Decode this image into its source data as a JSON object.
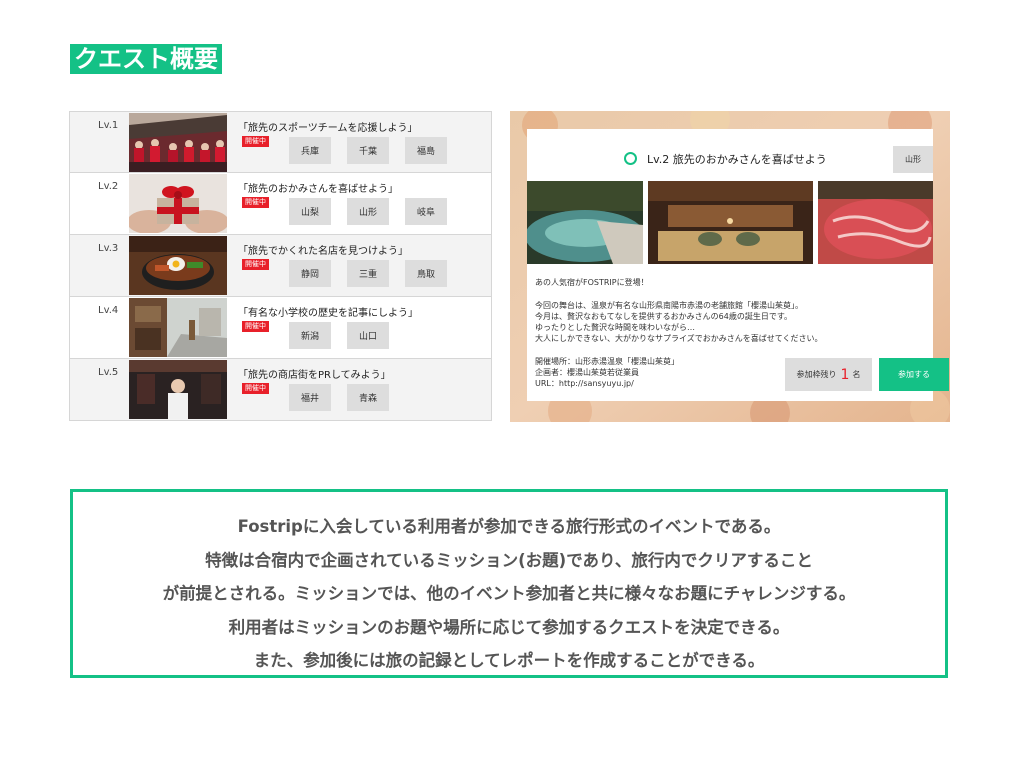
{
  "page_title": "クエスト概要",
  "quests": [
    {
      "level": "Lv.1",
      "title": "「旅先のスポーツチームを応援しよう」",
      "status": "開催中",
      "prefectures": [
        "兵庫",
        "千葉",
        "福島"
      ]
    },
    {
      "level": "Lv.2",
      "title": "「旅先のおかみさんを喜ばせよう」",
      "status": "開催中",
      "prefectures": [
        "山梨",
        "山形",
        "岐阜"
      ]
    },
    {
      "level": "Lv.3",
      "title": "「旅先でかくれた名店を見つけよう」",
      "status": "開催中",
      "prefectures": [
        "静岡",
        "三重",
        "鳥取"
      ]
    },
    {
      "level": "Lv.4",
      "title": "「有名な小学校の歴史を記事にしよう」",
      "status": "開催中",
      "prefectures": [
        "新潟",
        "山口"
      ]
    },
    {
      "level": "Lv.5",
      "title": "「旅先の商店街をPRしてみよう」",
      "status": "開催中",
      "prefectures": [
        "福井",
        "青森"
      ]
    }
  ],
  "detail": {
    "title": "Lv.2 旅先のおかみさんを喜ばせよう",
    "prefecture": "山形",
    "intro": "あの人気宿がFOSTRIPに登場！",
    "body": [
      "今回の舞台は、温泉が有名な山形県南陽市赤湯の老舗旅館「櫻湯山茱萸」。",
      "今月は、贅沢なおもてなしを提供するおかみさんの64歳の誕生日です。",
      "ゆったりとした贅沢な時間を味わいながら…",
      "大人にしかできない、大がかりなサプライズでおかみさんを喜ばせてください。"
    ],
    "info": [
      "開催場所：山形赤湯温泉「櫻湯山茱萸」",
      "企画者：櫻湯山茱萸若従業員",
      "URL：http://sansyuyu.jp/"
    ],
    "slots_label": "参加枠残り",
    "slots_count": "1",
    "slots_unit": "名",
    "join_label": "参加する"
  },
  "summary": [
    "Fostripに入会している利用者が参加できる旅行形式のイベントである。",
    "特徴は合宿内で企画されているミッション(お題)であり、旅行内でクリアすること",
    "が前提とされる。ミッションでは、他のイベント参加者と共に様々なお題にチャレンジする。",
    "利用者はミッションのお題や場所に応じて参加するクエストを決定できる。",
    "また、参加後には旅の記録としてレポートを作成することができる。"
  ],
  "colors": {
    "accent": "#14c186",
    "live_badge": "#e8202a",
    "chip": "#dddddd"
  }
}
